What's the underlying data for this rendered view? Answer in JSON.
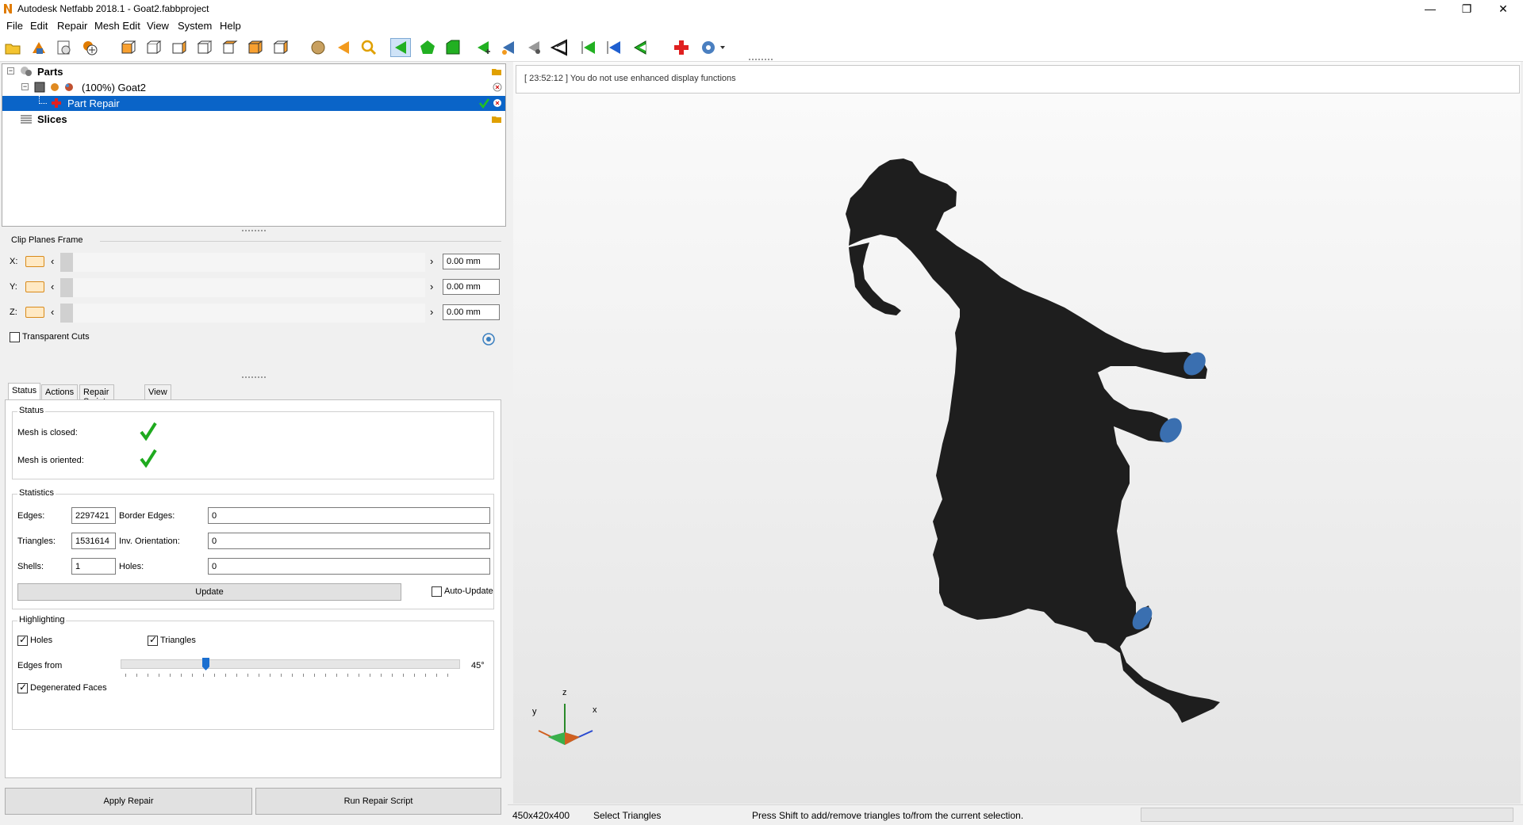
{
  "window": {
    "title": "Autodesk Netfabb 2018.1 - Goat2.fabbproject",
    "minimize": "—",
    "restore": "❐",
    "close": "✕"
  },
  "menu": [
    "File",
    "Edit",
    "Repair",
    "Mesh Edit",
    "View",
    "System",
    "Help"
  ],
  "toolbar": {
    "icons": [
      "open-icon",
      "add-part-icon",
      "new-part-icon",
      "add-icon",
      "view-front-icon",
      "view-back-icon",
      "view-left-icon",
      "view-right-icon",
      "view-top-icon",
      "view-bottom-icon",
      "view-iso-icon",
      "sphere-icon",
      "arrow-left-orange-icon",
      "zoom-icon",
      "select-triangles-icon",
      "select-shell-icon",
      "select-surface-icon",
      "add-triangle-icon",
      "flip-icon",
      "measure-icon",
      "cut-icon",
      "arrow-green-icon",
      "arrow-blue-icon",
      "arrow-green-outline-icon",
      "repair-cross-icon",
      "settings-dropdown-icon"
    ]
  },
  "tree": {
    "root": "Parts",
    "part": "(100%) Goat2",
    "repair": "Part Repair",
    "slices": "Slices"
  },
  "clip": {
    "title": "Clip Planes Frame",
    "rows": [
      {
        "axis": "X:",
        "value": "0.00 mm"
      },
      {
        "axis": "Y:",
        "value": "0.00 mm"
      },
      {
        "axis": "Z:",
        "value": "0.00 mm"
      }
    ],
    "transparent": "Transparent Cuts"
  },
  "tabs": [
    "Status",
    "Actions",
    "Repair Scripts",
    "View"
  ],
  "status": {
    "title": "Status",
    "closed": "Mesh is closed:",
    "oriented": "Mesh is oriented:"
  },
  "statistics": {
    "title": "Statistics",
    "edges_label": "Edges:",
    "edges": "2297421",
    "border_label": "Border Edges:",
    "border": "0",
    "triangles_label": "Triangles:",
    "triangles": "1531614",
    "inv_label": "Inv. Orientation:",
    "inv": "0",
    "shells_label": "Shells:",
    "shells": "1",
    "holes_label": "Holes:",
    "holes": "0",
    "update": "Update",
    "auto_update": "Auto-Update"
  },
  "highlighting": {
    "title": "Highlighting",
    "holes": "Holes",
    "triangles": "Triangles",
    "edges_from": "Edges from",
    "angle": "45°",
    "angle_value": 45,
    "degenerated": "Degenerated Faces"
  },
  "buttons": {
    "apply": "Apply Repair",
    "run_script": "Run Repair Script"
  },
  "viewport": {
    "message": "[ 23:52:12 ] You do not use enhanced display functions",
    "axis_x": "x",
    "axis_y": "y",
    "axis_z": "z",
    "model_color": "#1e1e1e",
    "hole_color": "#3a6fb0"
  },
  "statusbar": {
    "size": "450x420x400",
    "mode": "Select Triangles",
    "hint": "Press Shift to add/remove triangles to/from the current selection."
  }
}
